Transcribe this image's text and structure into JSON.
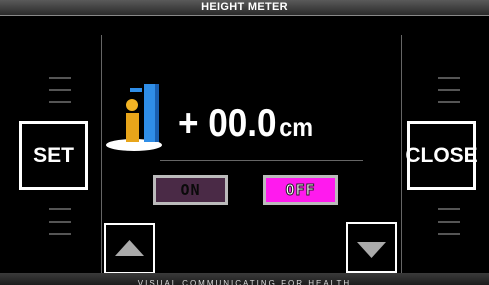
{
  "window": {
    "title": "HEIGHT METER"
  },
  "footer": {
    "tagline": "VISUAL COMMUNICATING FOR HEALTH"
  },
  "buttons": {
    "set": "SET",
    "close": "CLOSE"
  },
  "reading": {
    "sign": "+",
    "value": "00.0",
    "unit": "cm"
  },
  "toggles": {
    "on_label": "ON",
    "off_label": "OFF",
    "selected": "OFF"
  },
  "icons": {
    "logo": "height-meter-logo",
    "up": "triangle-up-icon",
    "down": "triangle-down-icon"
  },
  "colors": {
    "off_active": "#ff1aee",
    "on_inactive": "#4a2a46",
    "logo_blue": "#2f8ee8",
    "logo_gold": "#e8a51a"
  }
}
